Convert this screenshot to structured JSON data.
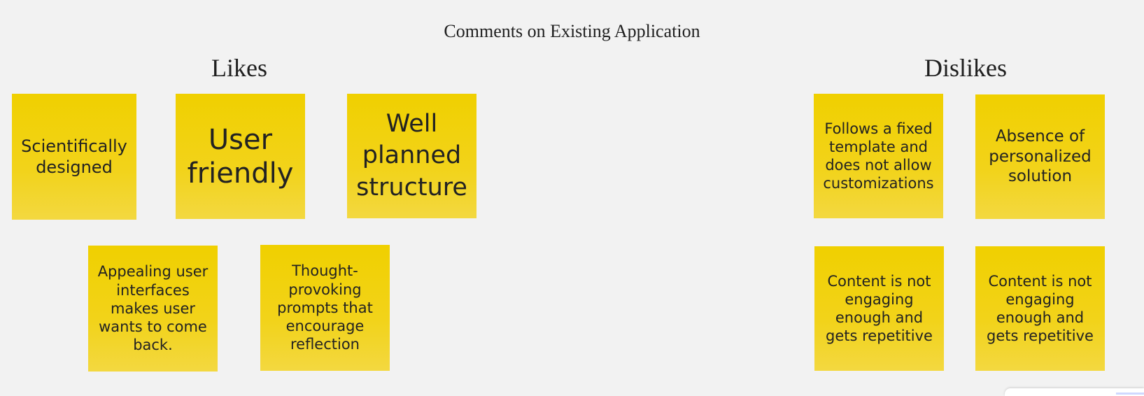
{
  "board": {
    "title": "Comments on Existing Application"
  },
  "likes": {
    "heading": "Likes",
    "notes": [
      {
        "text": "Scientifically\ndesigned"
      },
      {
        "text": "User\nfriendly"
      },
      {
        "text": "Well\nplanned\nstructure"
      },
      {
        "text": "Appealing user\ninterfaces\nmakes user\nwants to come\nback."
      },
      {
        "text": "Thought-\nprovoking\nprompts that\nencourage\nreflection"
      }
    ]
  },
  "dislikes": {
    "heading": "Dislikes",
    "notes": [
      {
        "text": "Follows a fixed\ntemplate and\ndoes not allow\ncustomizations"
      },
      {
        "text": "Absence of\npersonalized\nsolution"
      },
      {
        "text": "Content is not\nengaging\nenough and\ngets repetitive"
      },
      {
        "text": "Content is not\nengaging\nenough and\ngets repetitive"
      }
    ]
  },
  "colors": {
    "background": "#f2f2f2",
    "sticky_note": "#f0d000",
    "text": "#222222"
  }
}
